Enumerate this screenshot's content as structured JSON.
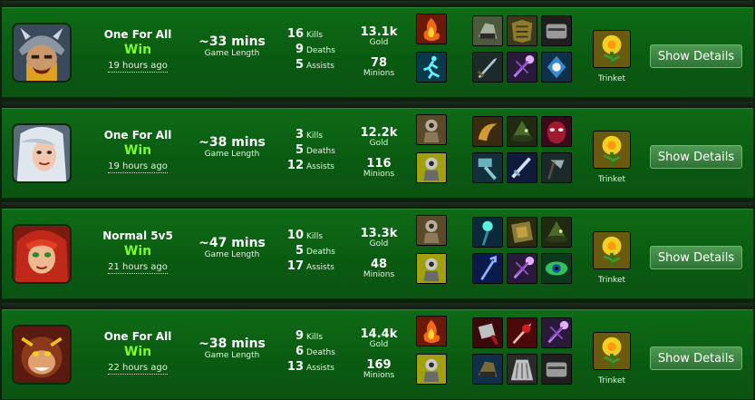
{
  "matches": [
    {
      "champion_icon": "bearded-viking-warrior-portrait",
      "mode": "One For All",
      "result": "Win",
      "time_ago": "19 hours ago",
      "game_length": "~33 mins",
      "game_length_label": "Game Length",
      "kills": "16",
      "kills_label": "Kills",
      "deaths": "9",
      "deaths_label": "Deaths",
      "assists": "5",
      "assists_label": "Assists",
      "gold": "13.1k",
      "gold_label": "Gold",
      "minions": "78",
      "minions_label": "Minions",
      "spells": [
        "ignite-spell-icon",
        "ghost-spell-icon"
      ],
      "items": [
        "boots-item-icon",
        "armor-item-icon",
        "helm-item-icon",
        "blade-item-icon",
        "staff-item-icon",
        "gem-item-icon"
      ],
      "trinket_label": "Trinket",
      "button_label": "Show Details"
    },
    {
      "champion_icon": "silver-haired-woman-portrait",
      "mode": "One For All",
      "result": "Win",
      "time_ago": "19 hours ago",
      "game_length": "~38 mins",
      "game_length_label": "Game Length",
      "kills": "3",
      "kills_label": "Kills",
      "deaths": "5",
      "deaths_label": "Deaths",
      "assists": "12",
      "assists_label": "Assists",
      "gold": "12.2k",
      "gold_label": "Gold",
      "minions": "116",
      "minions_label": "Minions",
      "spells": [
        "teleport-spell-icon",
        "flash-spell-icon"
      ],
      "items": [
        "horn-item-icon",
        "hat-item-icon",
        "mask-item-icon",
        "hammer-item-icon",
        "sword-item-icon",
        "axe-item-icon"
      ],
      "trinket_label": "Trinket",
      "button_label": "Show Details"
    },
    {
      "champion_icon": "red-haired-girl-portrait",
      "mode": "Normal 5v5",
      "result": "Win",
      "time_ago": "21 hours ago",
      "game_length": "~47 mins",
      "game_length_label": "Game Length",
      "kills": "10",
      "kills_label": "Kills",
      "deaths": "5",
      "deaths_label": "Deaths",
      "assists": "17",
      "assists_label": "Assists",
      "gold": "13.3k",
      "gold_label": "Gold",
      "minions": "48",
      "minions_label": "Minions",
      "spells": [
        "teleport-spell-icon",
        "flash-spell-icon"
      ],
      "items": [
        "orb-staff-item-icon",
        "tome-item-icon",
        "hat-item-icon",
        "trident-item-icon",
        "staff-item-icon",
        "eye-item-icon"
      ],
      "trinket_label": "Trinket",
      "button_label": "Show Details"
    },
    {
      "champion_icon": "monkey-warrior-portrait",
      "mode": "One For All",
      "result": "Win",
      "time_ago": "22 hours ago",
      "game_length": "~38 mins",
      "game_length_label": "Game Length",
      "kills": "9",
      "kills_label": "Kills",
      "deaths": "6",
      "deaths_label": "Deaths",
      "assists": "13",
      "assists_label": "Assists",
      "gold": "14.4k",
      "gold_label": "Gold",
      "minions": "169",
      "minions_label": "Minions",
      "spells": [
        "ignite-spell-icon",
        "flash-spell-icon"
      ],
      "items": [
        "cleaver-item-icon",
        "blade-item-icon",
        "staff-item-icon",
        "boots-item-icon",
        "cloak-item-icon",
        "helm-item-icon"
      ],
      "trinket_label": "Trinket",
      "button_label": "Show Details"
    }
  ]
}
